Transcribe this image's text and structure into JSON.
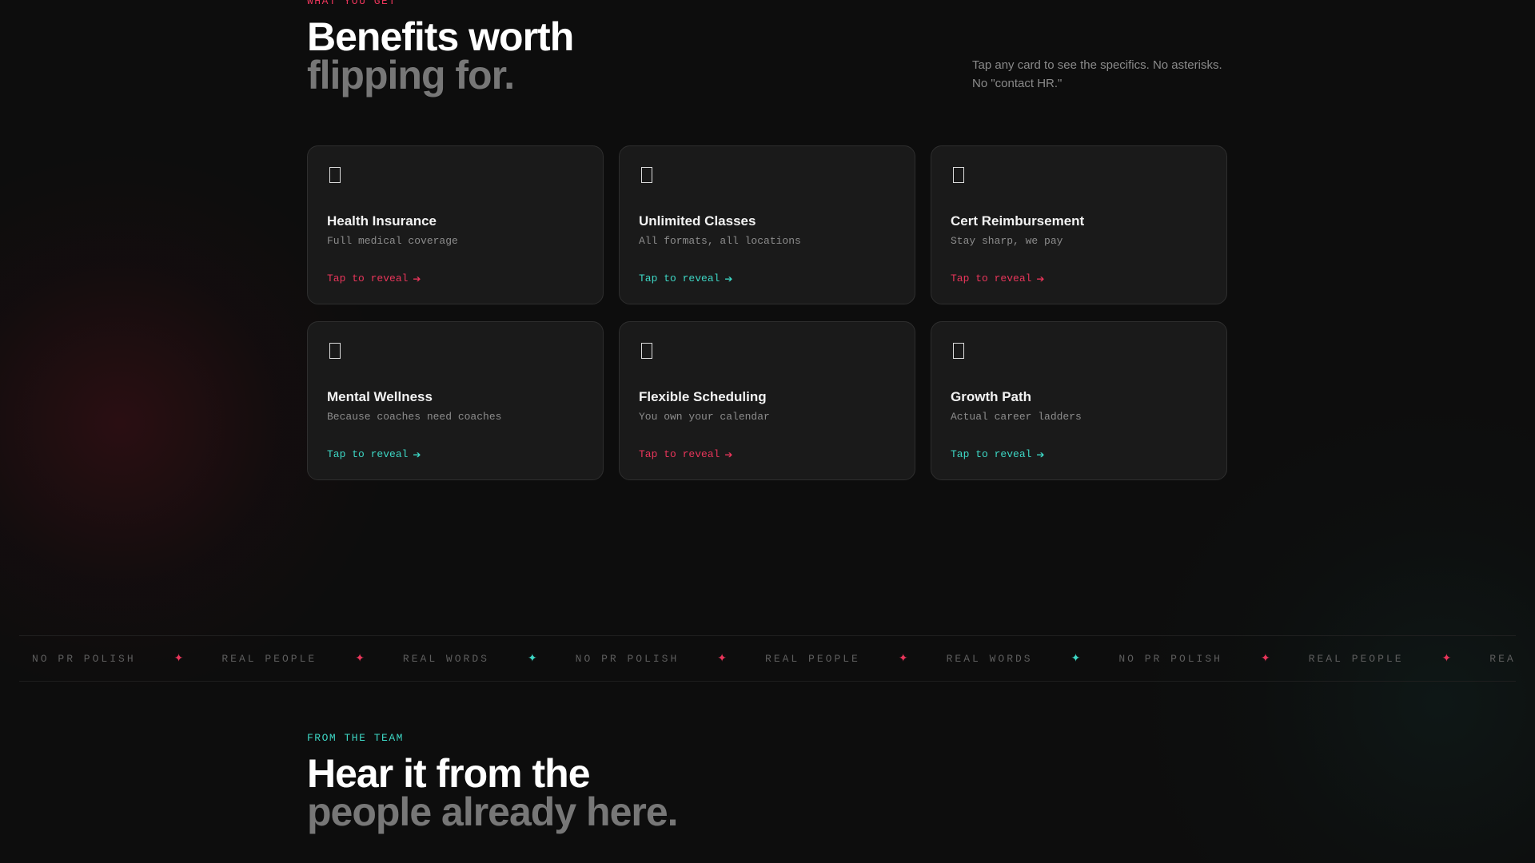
{
  "benefits": {
    "eyebrow": "WHAT YOU GET",
    "headline_line1": "Benefits worth",
    "headline_line2": "flipping for.",
    "side_note": "Tap any card to see the specifics. No asterisks. No \"contact HR.\"",
    "cards": [
      {
        "icon": "square-icon",
        "title": "Health Insurance",
        "subtitle": "Full medical coverage",
        "cta": "Tap to reveal",
        "accent": "#e8355a"
      },
      {
        "icon": "square-icon",
        "title": "Unlimited Classes",
        "subtitle": "All formats, all locations",
        "cta": "Tap to reveal",
        "accent": "#3dd6c4"
      },
      {
        "icon": "square-icon",
        "title": "Cert Reimbursement",
        "subtitle": "Stay sharp, we pay",
        "cta": "Tap to reveal",
        "accent": "#e8355a"
      },
      {
        "icon": "square-icon",
        "title": "Mental Wellness",
        "subtitle": "Because coaches need coaches",
        "cta": "Tap to reveal",
        "accent": "#3dd6c4"
      },
      {
        "icon": "square-icon",
        "title": "Flexible Scheduling",
        "subtitle": "You own your calendar",
        "cta": "Tap to reveal",
        "accent": "#e8355a"
      },
      {
        "icon": "square-icon",
        "title": "Growth Path",
        "subtitle": "Actual career ladders",
        "cta": "Tap to reveal",
        "accent": "#3dd6c4"
      }
    ]
  },
  "marquee": {
    "items": [
      "NO PR POLISH",
      "REAL PEOPLE",
      "REAL WORDS",
      "NO PR POLISH",
      "REAL PEOPLE",
      "REAL WORDS",
      "NO PR POLISH",
      "REAL PEOPLE",
      "REAL WORDS"
    ],
    "separator": "✦",
    "separator_colors": [
      "#e8355a",
      "#e8355a",
      "#3dd6c4",
      "#e8355a",
      "#e8355a",
      "#3dd6c4",
      "#e8355a",
      "#e8355a"
    ]
  },
  "team": {
    "eyebrow": "FROM THE TEAM",
    "headline_line1": "Hear it from the",
    "headline_line2": "people already here."
  },
  "colors": {
    "background": "#0d0d0d",
    "card": "#1a1a1a",
    "pink": "#e8355a",
    "teal": "#3dd6c4"
  }
}
